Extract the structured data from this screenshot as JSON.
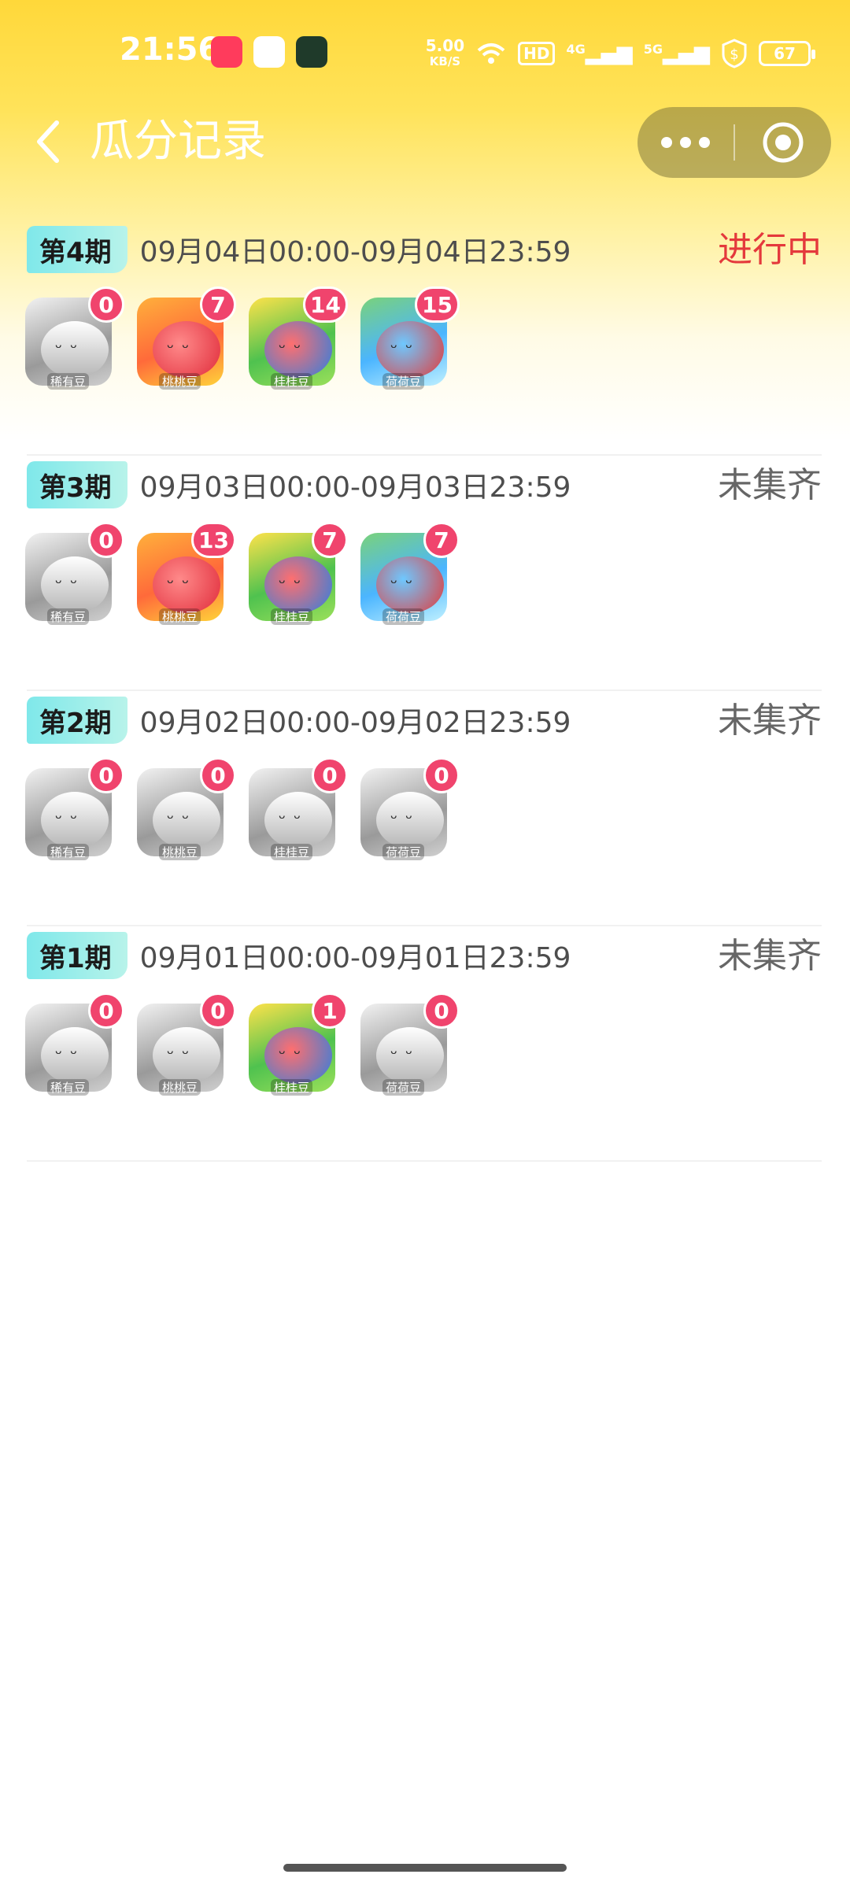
{
  "status_bar": {
    "time": "21:56",
    "net_speed_value": "5.00",
    "net_speed_unit": "KB/S",
    "hd": "HD",
    "sig1": "4G",
    "sig2": "5G",
    "battery": "67",
    "colors": {
      "music_app": "#ff3b5c",
      "game_app": "#ffffff",
      "manager_app": "#1f3a2a"
    }
  },
  "nav": {
    "title": "瓜分记录",
    "back_icon": "chevron-left-icon",
    "more_icon": "more-dots-icon",
    "close_icon": "target-close-icon"
  },
  "periods": [
    {
      "badge": "第4期",
      "range": "09月04日00:00-09月04日23:59",
      "status": "进行中",
      "active": true,
      "cards": [
        {
          "label": "稀有豆",
          "count": "0",
          "style": "gray"
        },
        {
          "label": "桃桃豆",
          "count": "7",
          "style": "c-peach"
        },
        {
          "label": "桂桂豆",
          "count": "14",
          "style": "c-flower"
        },
        {
          "label": "荷荷豆",
          "count": "15",
          "style": "c-leaf"
        }
      ]
    },
    {
      "badge": "第3期",
      "range": "09月03日00:00-09月03日23:59",
      "status": "未集齐",
      "active": false,
      "cards": [
        {
          "label": "稀有豆",
          "count": "0",
          "style": "gray"
        },
        {
          "label": "桃桃豆",
          "count": "13",
          "style": "c-peach"
        },
        {
          "label": "桂桂豆",
          "count": "7",
          "style": "c-flower"
        },
        {
          "label": "荷荷豆",
          "count": "7",
          "style": "c-leaf"
        }
      ]
    },
    {
      "badge": "第2期",
      "range": "09月02日00:00-09月02日23:59",
      "status": "未集齐",
      "active": false,
      "cards": [
        {
          "label": "稀有豆",
          "count": "0",
          "style": "gray"
        },
        {
          "label": "桃桃豆",
          "count": "0",
          "style": "gray"
        },
        {
          "label": "桂桂豆",
          "count": "0",
          "style": "gray"
        },
        {
          "label": "荷荷豆",
          "count": "0",
          "style": "gray"
        }
      ]
    },
    {
      "badge": "第1期",
      "range": "09月01日00:00-09月01日23:59",
      "status": "未集齐",
      "active": false,
      "cards": [
        {
          "label": "稀有豆",
          "count": "0",
          "style": "gray"
        },
        {
          "label": "桃桃豆",
          "count": "0",
          "style": "gray"
        },
        {
          "label": "桂桂豆",
          "count": "1",
          "style": "c-flower"
        },
        {
          "label": "荷荷豆",
          "count": "0",
          "style": "gray"
        }
      ]
    }
  ]
}
